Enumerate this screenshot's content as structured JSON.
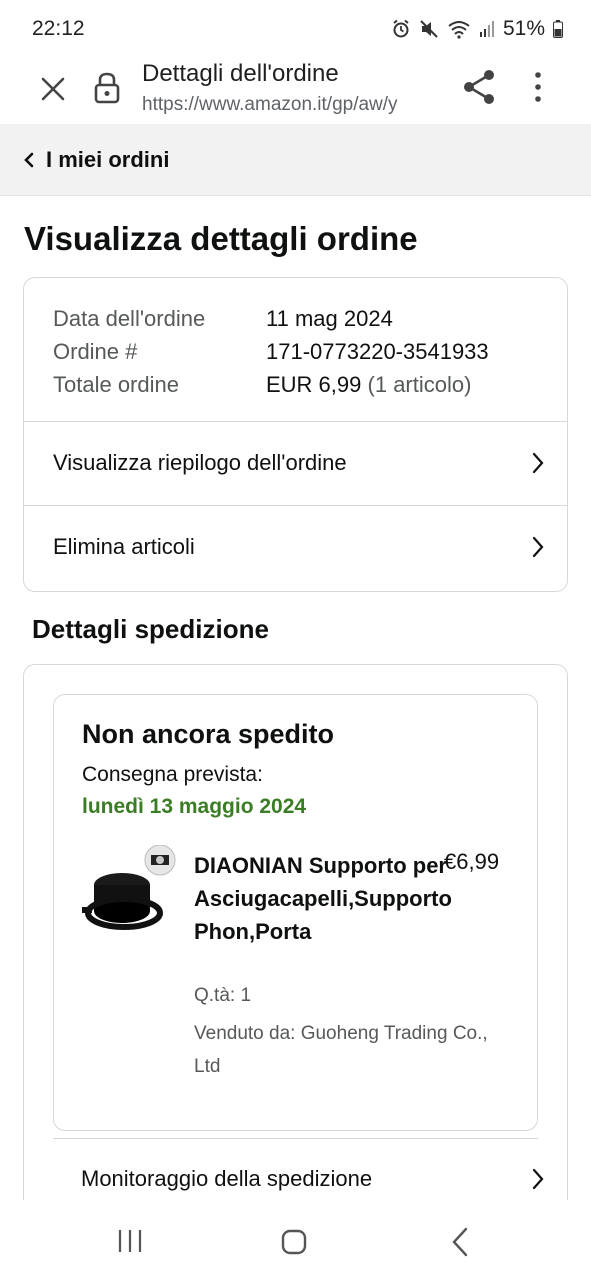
{
  "status_bar": {
    "time": "22:12",
    "battery": "51%"
  },
  "browser": {
    "title": "Dettagli dell'ordine",
    "url": "https://www.amazon.it/gp/aw/y"
  },
  "nav": {
    "back_label": "I miei ordini"
  },
  "page": {
    "title": "Visualizza dettagli ordine"
  },
  "order": {
    "date_label": "Data dell'ordine",
    "date_value": "11 mag 2024",
    "number_label": "Ordine #",
    "number_value": "171-0773220-3541933",
    "total_label": "Totale ordine",
    "total_value": "EUR 6,99",
    "total_items": "(1 articolo)",
    "links": [
      {
        "label": "Visualizza riepilogo dell'ordine"
      },
      {
        "label": "Elimina articoli"
      }
    ]
  },
  "shipment": {
    "section_title": "Dettagli spedizione",
    "status": "Non ancora spedito",
    "delivery_label": "Consegna prevista:",
    "delivery_date": "lunedì 13 maggio 2024",
    "product": {
      "name": "DIAONIAN Supporto per Asciugacapelli,Supporto Phon,Porta",
      "price": "€6,99",
      "qty": "Q.tà: 1",
      "seller": "Venduto da: Guoheng Trading Co., Ltd"
    },
    "track_label": "Monitoraggio della spedizione"
  },
  "colors": {
    "delivery_green": "#3a7d24",
    "border": "#d5d9d9",
    "muted_text": "#565959"
  }
}
